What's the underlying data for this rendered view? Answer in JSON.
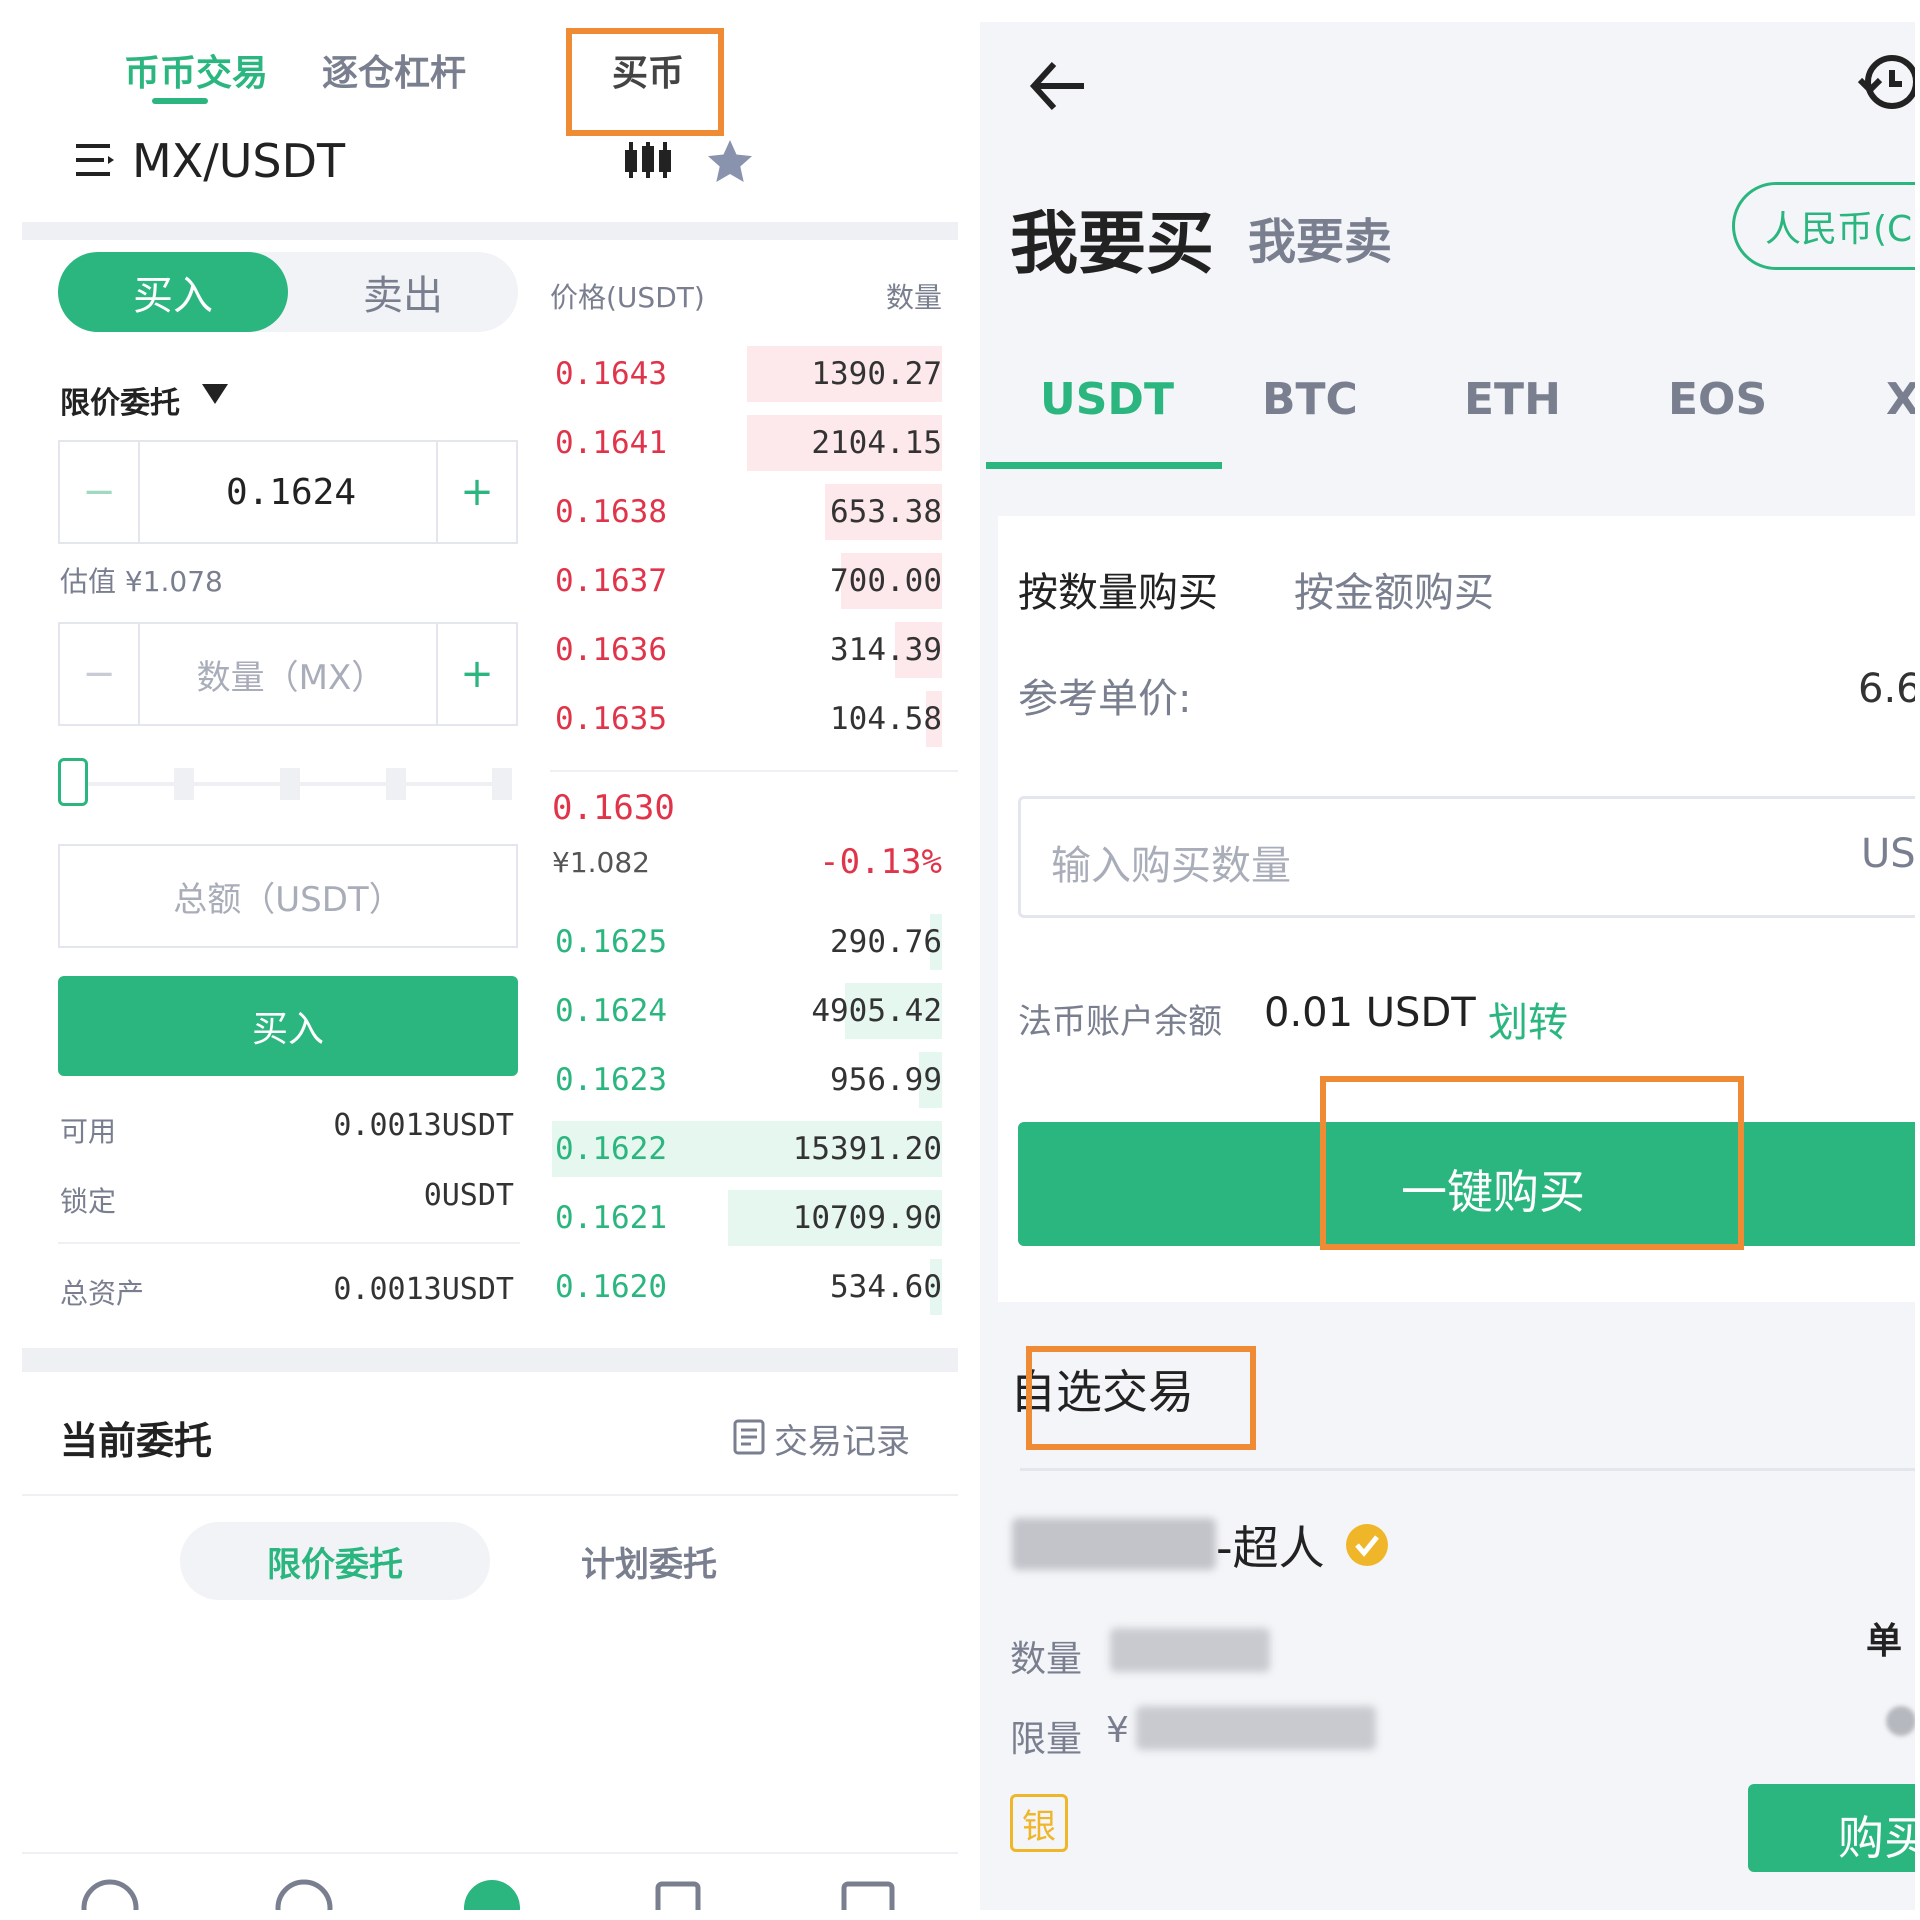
{
  "left": {
    "tabs": [
      "币币交易",
      "逐仓杠杆",
      "买币"
    ],
    "pair": "MX/USDT",
    "side_buy": "买入",
    "side_sell": "卖出",
    "order_type": "限价委托",
    "price_value": "0.1624",
    "estimate": "估值 ¥1.078",
    "qty_placeholder": "数量（MX）",
    "total_placeholder": "总额（USDT）",
    "buy_button": "买入",
    "balances": [
      {
        "label": "可用",
        "value": "0.0013USDT"
      },
      {
        "label": "锁定",
        "value": "0USDT"
      },
      {
        "label": "总资产",
        "value": "0.0013USDT"
      }
    ],
    "orderbook": {
      "price_header": "价格(USDT)",
      "qty_header": "数量",
      "asks": [
        {
          "price": "0.1643",
          "qty": "1390.27",
          "depth": 0.5
        },
        {
          "price": "0.1641",
          "qty": "2104.15",
          "depth": 0.5
        },
        {
          "price": "0.1638",
          "qty": "653.38",
          "depth": 0.3
        },
        {
          "price": "0.1637",
          "qty": "700.00",
          "depth": 0.26
        },
        {
          "price": "0.1636",
          "qty": "314.39",
          "depth": 0.12
        },
        {
          "price": "0.1635",
          "qty": "104.58",
          "depth": 0.04
        }
      ],
      "last_price": "0.1630",
      "last_cny": "¥1.082",
      "change": "-0.13%",
      "bids": [
        {
          "price": "0.1625",
          "qty": "290.76",
          "depth": 0.03
        },
        {
          "price": "0.1624",
          "qty": "4905.42",
          "depth": 0.25
        },
        {
          "price": "0.1623",
          "qty": "956.99",
          "depth": 0.06
        },
        {
          "price": "0.1622",
          "qty": "15391.20",
          "depth": 1.0
        },
        {
          "price": "0.1621",
          "qty": "10709.90",
          "depth": 0.55
        },
        {
          "price": "0.1620",
          "qty": "534.60",
          "depth": 0.03
        }
      ]
    },
    "current_orders": "当前委托",
    "trade_records": "交易记录",
    "bottom_tabs": [
      "限价委托",
      "计划委托"
    ]
  },
  "right": {
    "buy_tab": "我要买",
    "sell_tab": "我要卖",
    "currency_btn": "人民币(C",
    "coins": [
      "USDT",
      "BTC",
      "ETH",
      "EOS",
      "X"
    ],
    "mode_qty": "按数量购买",
    "mode_amount": "按金额购买",
    "ref_price_label": "参考单价:",
    "ref_price_value": "6.6",
    "input_placeholder": "输入购买数量",
    "input_unit": "US",
    "balance_label": "法币账户余额",
    "balance_value": "0.01 USDT",
    "transfer": "划转",
    "one_click_buy": "一键购买",
    "section_title": "自选交易",
    "merchant_suffix": "-超人",
    "qty_label": "数量",
    "limit_label": "限量",
    "limit_prefix": "¥",
    "unit_label": "单",
    "silver_badge": "银",
    "buy_button": "购买"
  },
  "colors": {
    "green": "#2bb67f",
    "red": "#e0344a",
    "highlight": "#f08b35",
    "muted": "#7a7f90"
  }
}
